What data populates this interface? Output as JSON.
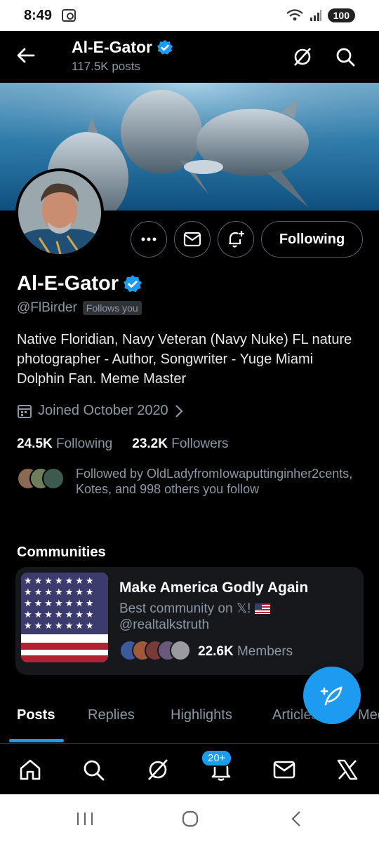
{
  "status_bar": {
    "time": "8:49",
    "battery": "100"
  },
  "header": {
    "name": "Al-E-Gator",
    "posts": "117.5K posts"
  },
  "profile": {
    "name": "Al-E-Gator",
    "handle": "@FlBirder",
    "follows_you": "Follows you",
    "bio": "Native Floridian, Navy Veteran (Navy Nuke) FL nature photographer - Author, Songwriter - Yuge Miami Dolphin Fan. Meme Master",
    "joined": "Joined October 2020",
    "following_count": "24.5K",
    "following_label": "Following",
    "followers_count": "23.2K",
    "followers_label": "Followers",
    "followed_by": "Followed by OldLadyfromIowaputtinginher2cents, Kotes, and 998 others you follow",
    "follow_button": "Following"
  },
  "communities": {
    "title": "Communities",
    "name": "Make America Godly Again",
    "desc_line1": "Best community on 𝕏!",
    "desc_line2": "@realtalkstruth",
    "members_count": "22.6K",
    "members_label": "Members"
  },
  "tabs": [
    {
      "label": "Posts"
    },
    {
      "label": "Replies"
    },
    {
      "label": "Highlights"
    },
    {
      "label": "Articles"
    },
    {
      "label": "Media"
    }
  ],
  "bottom_nav": {
    "badge": "20+"
  },
  "colors": {
    "accent": "#1d9bf0",
    "background": "#000000",
    "muted": "#8b98a5"
  }
}
